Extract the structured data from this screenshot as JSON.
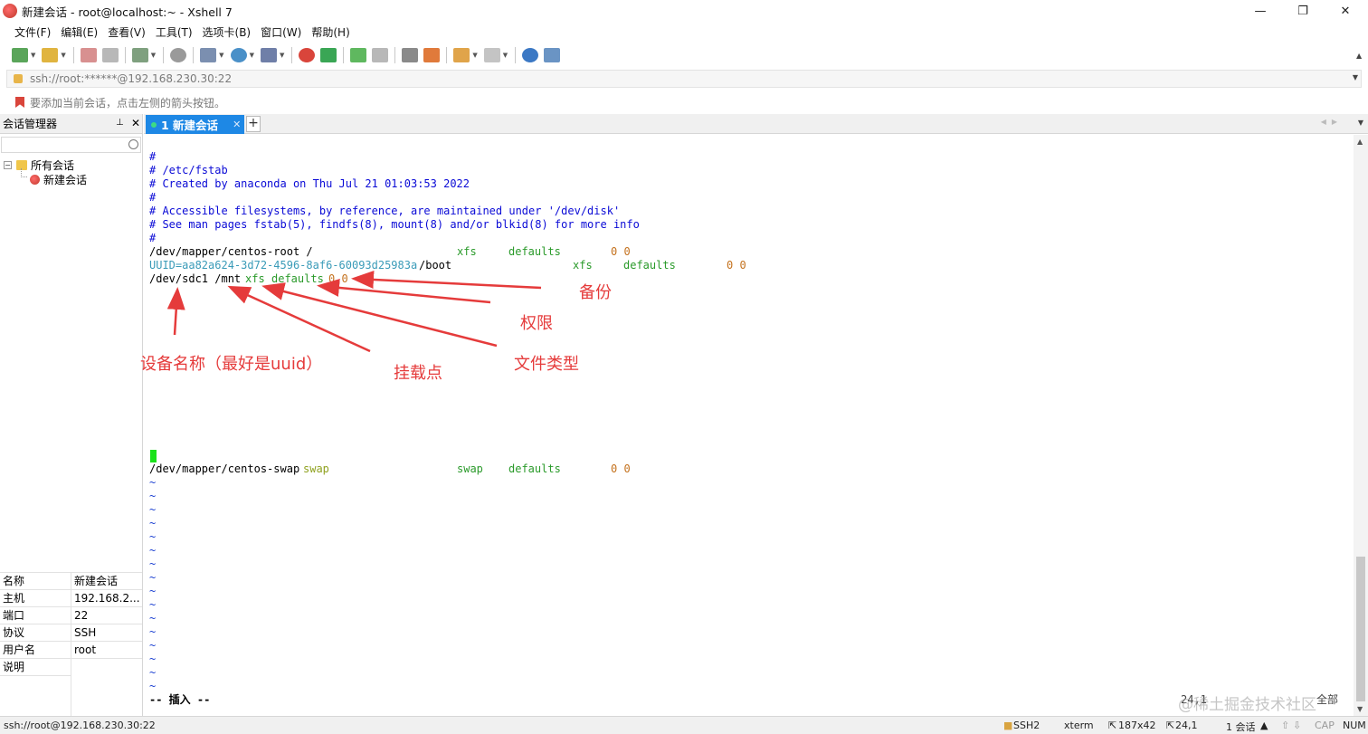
{
  "window": {
    "title": "新建会话 - root@localhost:~ - Xshell 7"
  },
  "menu": [
    "文件(F)",
    "编辑(E)",
    "查看(V)",
    "工具(T)",
    "选项卡(B)",
    "窗口(W)",
    "帮助(H)"
  ],
  "address": {
    "text": "ssh://root:******@192.168.230.30:22"
  },
  "hint": {
    "text": "要添加当前会话，点击左侧的箭头按钮。"
  },
  "session_manager": {
    "title": "会话管理器",
    "tree_root": "所有会话",
    "tree_child": "新建会话",
    "properties": [
      {
        "key": "名称",
        "value": "新建会话"
      },
      {
        "key": "主机",
        "value": "192.168.2..."
      },
      {
        "key": "端口",
        "value": "22"
      },
      {
        "key": "协议",
        "value": "SSH"
      },
      {
        "key": "用户名",
        "value": "root"
      },
      {
        "key": "说明",
        "value": ""
      }
    ]
  },
  "tabs": [
    {
      "label": "1 新建会话"
    }
  ],
  "terminal": {
    "line1": "#",
    "line2": "# /etc/fstab",
    "line3": "# Created by anaconda on Thu Jul 21 01:03:53 2022",
    "line4": "#",
    "line5": "# Accessible filesystems, by reference, are maintained under '/dev/disk'",
    "line6": "# See man pages fstab(5), findfs(8), mount(8) and/or blkid(8) for more info",
    "line7": "#",
    "root": {
      "dev": "/dev/mapper/centos-root /",
      "fs": "xfs",
      "opts": "defaults",
      "num": "0 0"
    },
    "boot": {
      "uuid": "UUID=aa82a624-3d72-4596-8af6-60093d25983a",
      "mount": "/boot",
      "fs": "xfs",
      "opts": "defaults",
      "num": "0 0"
    },
    "sdc": {
      "dev": "/dev/sdc1 /mnt",
      "fs": "xfs",
      "opts": "defaults",
      "num": "0 0"
    },
    "swap": {
      "dev": "/dev/mapper/centos-swap",
      "mount": "swap",
      "fs": "swap",
      "opts": "defaults",
      "num": "0 0"
    },
    "tilde": "~",
    "mode": "-- 插入 --",
    "position": "24,1",
    "scroll_pos": "全部"
  },
  "annotations": {
    "backup": "备份",
    "permission": "权限",
    "device_name": "设备名称（最好是uuid）",
    "mount_point": "挂载点",
    "file_type": "文件类型"
  },
  "status": {
    "left": "ssh://root@192.168.230.30:22",
    "protocol": "SSH2",
    "terminal_type": "xterm",
    "size": "187x42",
    "cursor": "24,1",
    "sessions": "1 会话",
    "cap": "CAP",
    "num": "NUM"
  },
  "watermark": "@稀土掘金技术社区",
  "colors": {
    "accent": "#1e88e5",
    "annotation": "#e53b3b",
    "comment": "#0a0ad6",
    "cursor": "#1be21b"
  }
}
